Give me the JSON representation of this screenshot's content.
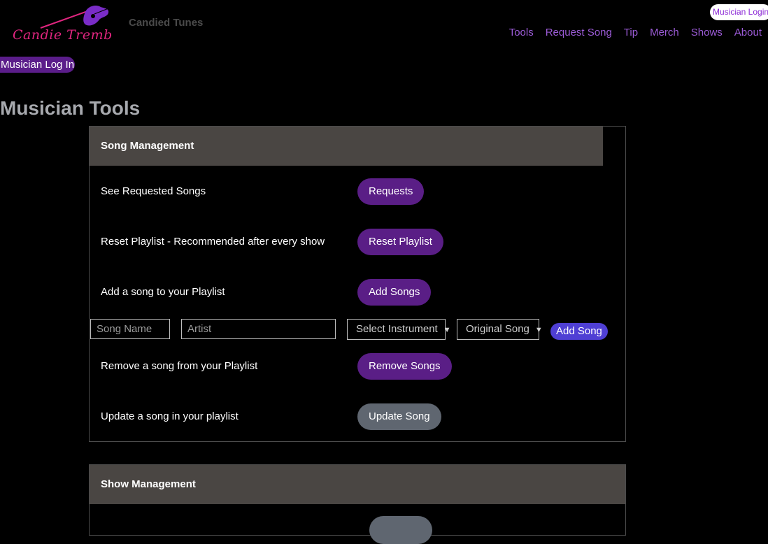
{
  "header": {
    "logo_text": "Candie Tremblay",
    "site_name": "Candied Tunes",
    "login_pill": "Musician Login",
    "nav": [
      "Tools",
      "Request Song",
      "Tip",
      "Merch",
      "Shows",
      "About"
    ]
  },
  "musician_login_button": "Musician Log In",
  "page_title": "Musician Tools",
  "song_management": {
    "title": "Song Management",
    "rows": [
      {
        "label": "See Requested Songs",
        "button": "Requests"
      },
      {
        "label": "Reset Playlist - Recommended after every show",
        "button": "Reset Playlist"
      },
      {
        "label": "Add a song to your Playlist",
        "button": "Add Songs"
      },
      {
        "label": "Remove a song from your Playlist",
        "button": "Remove Songs"
      },
      {
        "label": "Update a song in your playlist",
        "button": "Update Song"
      }
    ],
    "add_form": {
      "song_name_placeholder": "Song Name",
      "artist_placeholder": "Artist",
      "instrument_selected": "Select Instrument",
      "song_type_selected": "Original Song",
      "submit_label": "Add Song"
    }
  },
  "show_management": {
    "title": "Show Management"
  },
  "colors": {
    "primary_button": "#5a1e86",
    "secondary_button": "#5f6670",
    "nav_link": "#9b5bd6",
    "card_header": "#4a4643",
    "add_song_button": "#4f3fd4",
    "logo_pink": "#e0257f",
    "logo_purple": "#7a2cc7"
  }
}
